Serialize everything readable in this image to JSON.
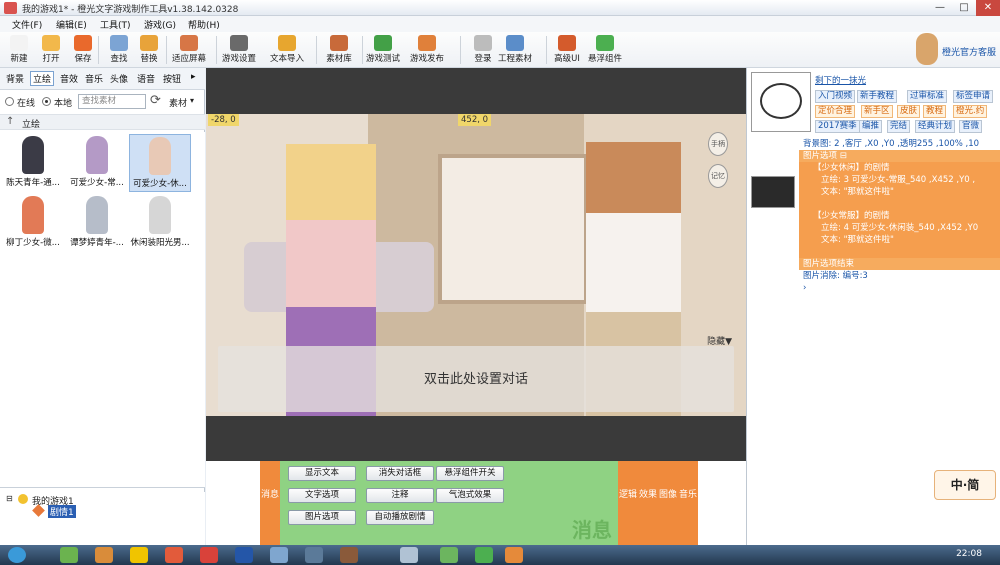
{
  "window": {
    "title": "我的游戏1* - 橙光文字游戏制作工具v1.38.142.0328",
    "min": "—",
    "max": "□",
    "close": "✕"
  },
  "menu": [
    "文件(F)",
    "编辑(E)",
    "工具(T)",
    "游戏(G)",
    "帮助(H)"
  ],
  "toolbar": [
    {
      "label": "新建",
      "icon": "new-file-icon",
      "color": "#f3f3f3"
    },
    {
      "label": "打开",
      "icon": "open-folder-icon",
      "color": "#f2b84b"
    },
    {
      "label": "保存",
      "icon": "save-icon",
      "color": "#e9692c"
    },
    {
      "label": "查找",
      "icon": "find-icon",
      "color": "#7ca4d4"
    },
    {
      "label": "替换",
      "icon": "replace-icon",
      "color": "#e8a33a"
    },
    {
      "label": "适应屏幕",
      "icon": "fit-screen-icon",
      "color": "#d77646"
    },
    {
      "label": "游戏设置",
      "icon": "settings-gear-icon",
      "color": "#6a6a6a"
    },
    {
      "label": "文本导入",
      "icon": "text-import-icon",
      "color": "#e7a62f"
    },
    {
      "label": "素材库",
      "icon": "asset-library-icon",
      "color": "#c86a3a"
    },
    {
      "label": "游戏测试",
      "icon": "test-play-icon",
      "color": "#43a047"
    },
    {
      "label": "游戏发布",
      "icon": "publish-icon",
      "color": "#e0803a"
    },
    {
      "label": "登录",
      "icon": "login-star-icon",
      "color": "#bcbcbc"
    },
    {
      "label": "工程素材",
      "icon": "project-assets-icon",
      "color": "#5b8dc9"
    },
    {
      "label": "高级UI",
      "icon": "advanced-ui-icon",
      "color": "#d45b2c"
    },
    {
      "label": "悬浮组件",
      "icon": "floating-component-icon",
      "color": "#4caf50"
    }
  ],
  "support": {
    "label": "橙光官方客服"
  },
  "left": {
    "categories": [
      "背景",
      "立绘",
      "音效",
      "音乐",
      "头像",
      "语音",
      "按钮"
    ],
    "more": "▸",
    "source": {
      "online": "在线",
      "local": "本地",
      "search_placeholder": "查找素材",
      "refresh": "⟳",
      "asset": "素材"
    },
    "path": "立绘",
    "thumbs": [
      {
        "name": "陈天青年-通..."
      },
      {
        "name": "可爱少女-常..."
      },
      {
        "name": "可爱少女-休..."
      },
      {
        "name": "柳丁少女-微..."
      },
      {
        "name": "谭梦婷青年-..."
      },
      {
        "name": "休闲装阳光男..."
      }
    ],
    "tree": {
      "root": "我的游戏1",
      "child": "剧情1"
    }
  },
  "stage": {
    "coord_left": "-28, 0",
    "coord_right": "452, 0",
    "dialog": "双击此处设置对话",
    "hide": "隐藏▼",
    "chip1": "手柄",
    "chip2": "记忆"
  },
  "commands": {
    "left_tab": "消息",
    "buttons": [
      "显示文本",
      "消失对话框",
      "悬浮组件开关",
      "文字选项",
      "注释",
      "气泡式效果",
      "图片选项",
      "自动播放剧情"
    ],
    "watermark": "消息",
    "right_tabs": [
      "逻辑",
      "效果",
      "图像",
      "音乐"
    ]
  },
  "right": {
    "author": "剩下的一抹光",
    "tags": [
      "入门视频",
      "新手教程",
      "过审标准",
      "标签申请",
      "定价合理",
      "新手区",
      "皮肤",
      "教程",
      "橙光.约",
      "2017赛季",
      "编推",
      "完结",
      "经典计划",
      "官微"
    ],
    "timeline": [
      "背景图: 2 ,客厅 ,X0 ,Y0 ,透明255 ,100% ,10",
      "图片选项 ⊟",
      "【少女休闲】的剧情",
      "立绘: 3  可爱少女-常服_540 ,X452 ,Y0 ,",
      "文本: \"那就这件啦\"",
      "",
      "【少女常服】的剧情",
      "立绘: 4  可爱少女-休闲装_540 ,X452 ,Y0",
      "文本: \"那就这件啦\"",
      "",
      "图片选项结束",
      "图片消除: 编号:3",
      "›"
    ],
    "ime": "中·简"
  },
  "taskbar": {
    "clock": "22:08"
  }
}
